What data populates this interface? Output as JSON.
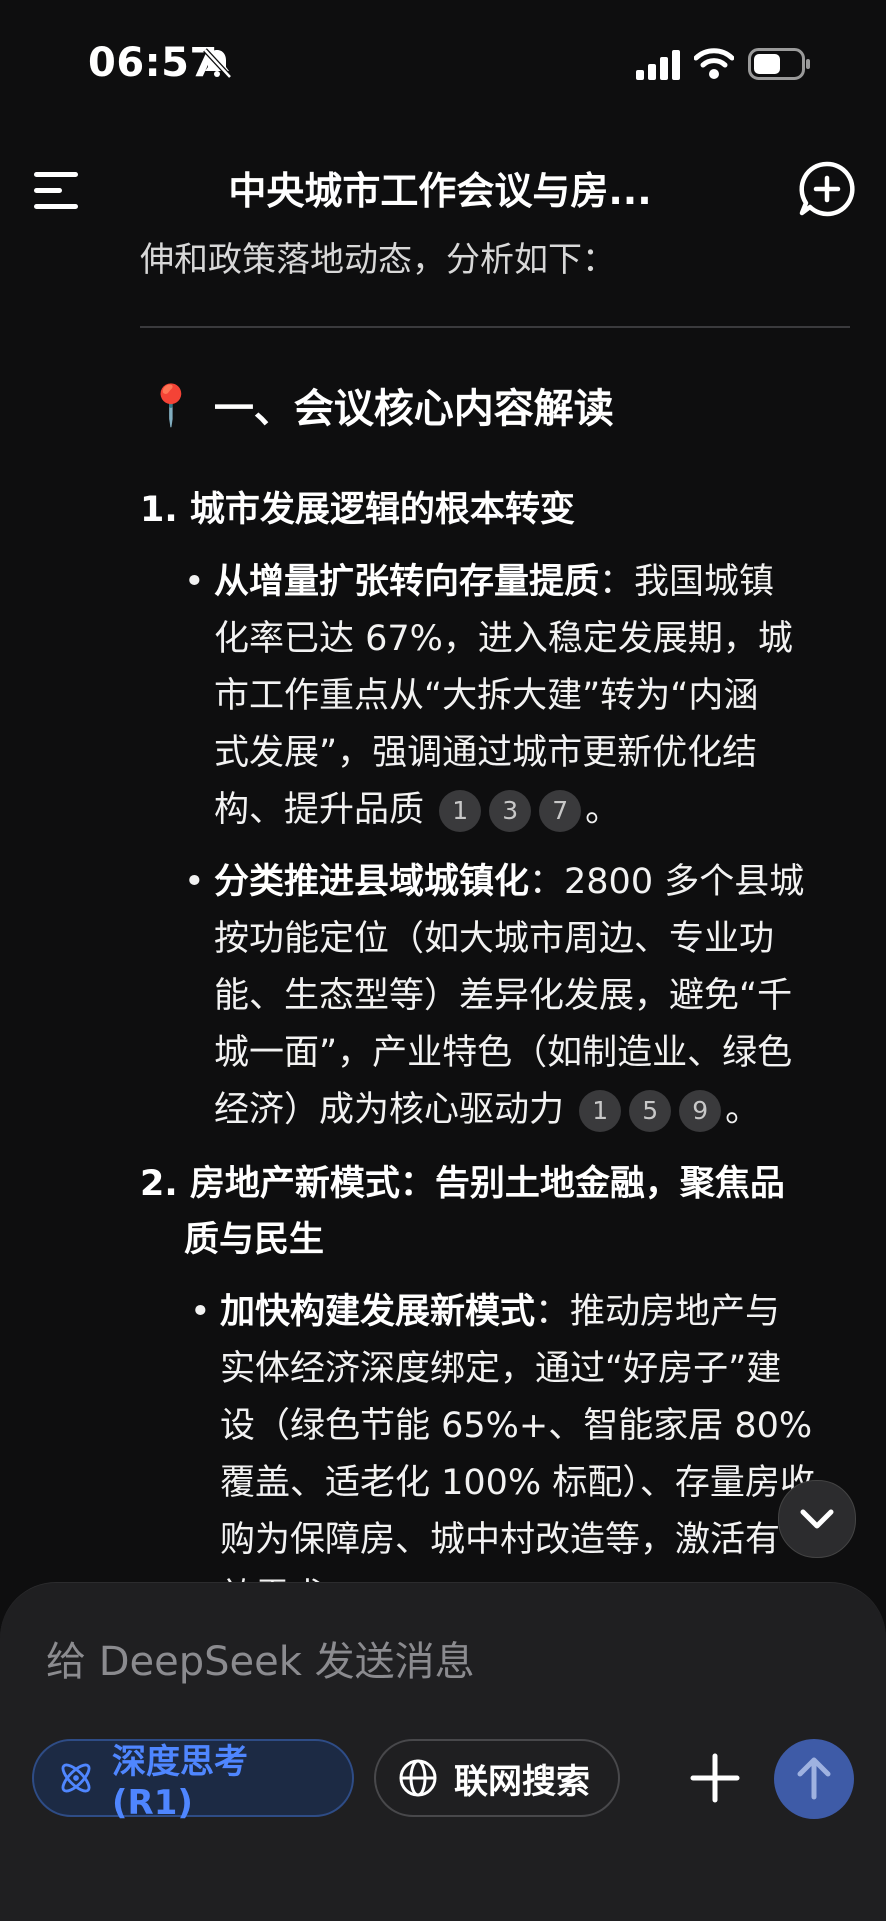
{
  "status_bar": {
    "time": "06:57"
  },
  "header": {
    "title": "中央城市工作会议与房..."
  },
  "content": {
    "partial_line": "伸和政策落地动态，分析如下：",
    "section_heading": "一、会议核心内容解读",
    "item1": {
      "label": "1. 城市发展逻辑的根本转变",
      "bullet1": {
        "bold": "从增量扩张转向存量提质",
        "line1": "：我国城镇",
        "line2": "化率已达 67%，进入稳定发展期，城",
        "line3": "市工作重点从“大拆大建”转为“内涵",
        "line4": "式发展”，强调通过城市更新优化结",
        "line5": "构、提升品质",
        "end": "。",
        "cites": [
          "1",
          "3",
          "7"
        ]
      },
      "bullet2": {
        "bold": "分类推进县域城镇化",
        "line1": "：2800 多个县城",
        "line2": "按功能定位（如大城市周边、专业功",
        "line3": "能、生态型等）差异化发展，避免“千",
        "line4": "城一面”，产业特色（如制造业、绿色",
        "line5": "经济）成为核心驱动力",
        "end": "。",
        "cites": [
          "1",
          "5",
          "9"
        ]
      }
    },
    "item2": {
      "label_line1": "2. 房地产新模式：告别土地金融，聚焦品",
      "label_line2": "质与民生",
      "bullet1": {
        "bold": "加快构建发展新模式",
        "line1": "：推动房地产与",
        "line2": "实体经济深度绑定，通过“好房子”建",
        "line3": "设（绿色节能 65%+、智能家居 80%",
        "line4": "覆盖、适老化 100% 标配）、存量房收",
        "line5": "购为保障房、城中村改造等，激活有",
        "line6": "效需求"
      }
    }
  },
  "composer": {
    "placeholder": "给 DeepSeek 发送消息",
    "deep_think_label": "深度思考 (R1)",
    "web_search_label": "联网搜索"
  },
  "colors": {
    "accent": "#4f86ff",
    "send_bg": "#3e5ba7",
    "background": "#0e0e0f"
  }
}
